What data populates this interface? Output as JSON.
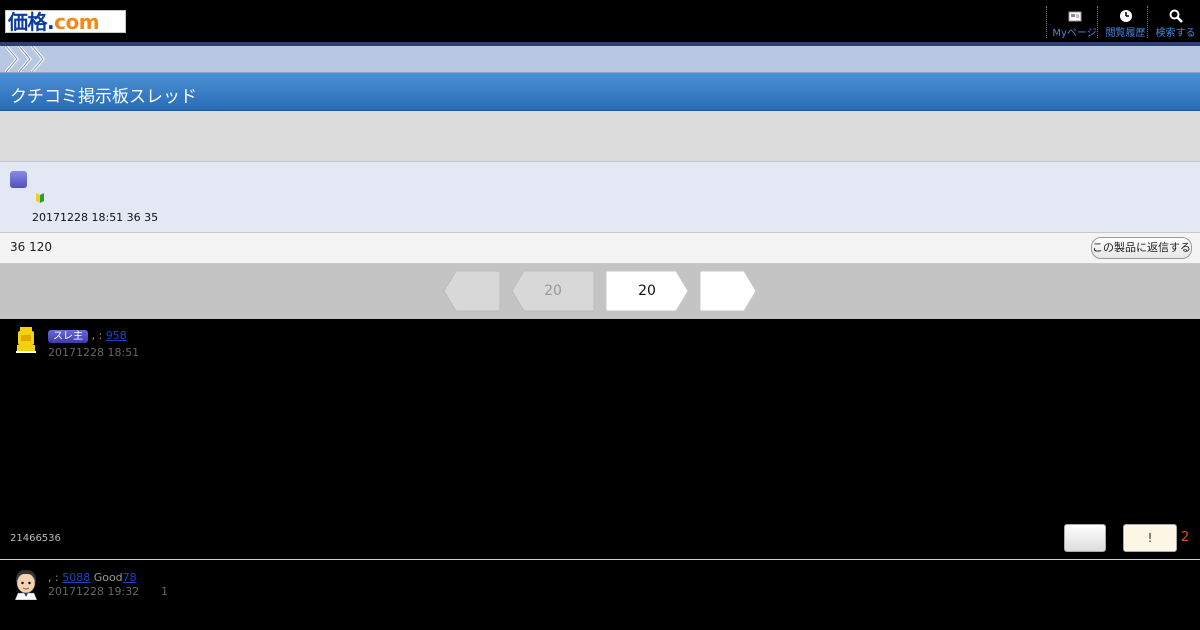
{
  "header": {
    "logo_main": "価格",
    "logo_dot": ".",
    "logo_com": "com",
    "nav": [
      {
        "icon": "my-page-icon",
        "label": "Myページ"
      },
      {
        "icon": "history-icon",
        "label": "閲覧履歴"
      },
      {
        "icon": "search-icon",
        "label": "検索する"
      }
    ]
  },
  "title": "クチコミ掲示板スレッド",
  "thread": {
    "posted_meta": "20171228 18:51 36 35",
    "count_text": "36 120",
    "reply_button": "この製品に返信する"
  },
  "pager": {
    "prev_label": "",
    "first_label": "20",
    "current_label": "20",
    "next_label": ""
  },
  "posts": [
    {
      "badge": "スレ主",
      "sep": ", :",
      "count_link": "958",
      "date": "20171228 18:51",
      "post_id": "21466536",
      "helpful_label": "!",
      "helpful_count": "2"
    },
    {
      "sep": ", :",
      "count_link": "5088",
      "good_label": "Good",
      "good_link": "78",
      "date": "20171228 19:32",
      "reply_no": "1"
    }
  ],
  "colors": {
    "logo_blue": "#0c3d9c",
    "logo_orange": "#f08a1c",
    "title_bar": "#3a7ec6",
    "crumb": "#b8c8e2",
    "link": "#2044c8",
    "helpful_count": "#e05030"
  }
}
